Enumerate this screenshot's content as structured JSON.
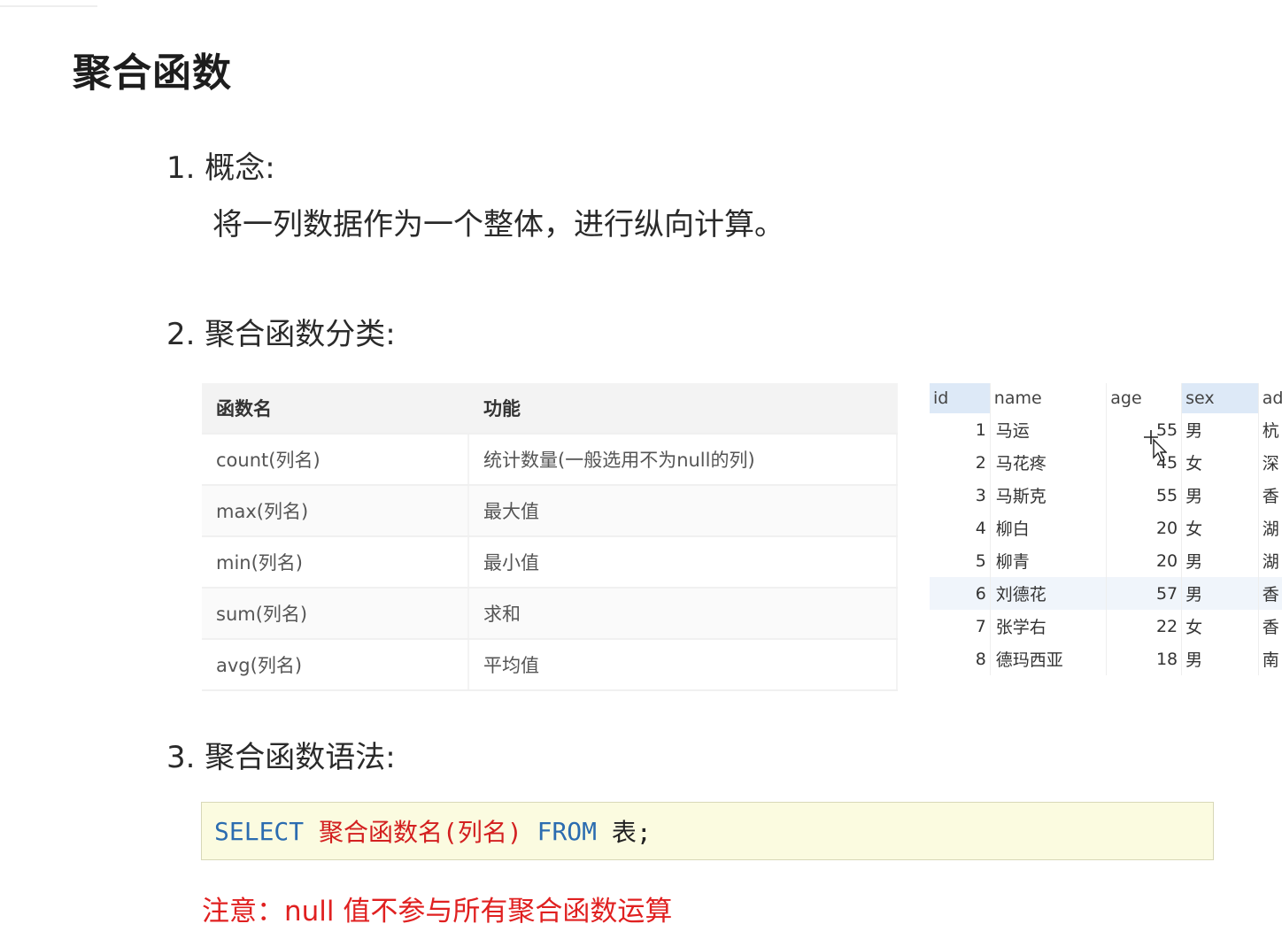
{
  "page_title": "聚合函数",
  "sections": {
    "concept_heading": "1. 概念:",
    "concept_body": "将一列数据作为一个整体，进行纵向计算。",
    "categories_heading": "2. 聚合函数分类:",
    "syntax_heading": "3. 聚合函数语法:"
  },
  "function_table": {
    "headers": [
      "函数名",
      "功能"
    ],
    "rows": [
      [
        "count(列名)",
        "统计数量(一般选用不为null的列)"
      ],
      [
        "max(列名)",
        "最大值"
      ],
      [
        "min(列名)",
        "最小值"
      ],
      [
        "sum(列名)",
        "求和"
      ],
      [
        "avg(列名)",
        "平均值"
      ]
    ]
  },
  "data_table": {
    "headers": [
      "id",
      "name",
      "age",
      "sex",
      "ad"
    ],
    "rows": [
      [
        "1",
        "马运",
        "55",
        "男",
        "杭"
      ],
      [
        "2",
        "马花疼",
        "45",
        "女",
        "深"
      ],
      [
        "3",
        "马斯克",
        "55",
        "男",
        "香"
      ],
      [
        "4",
        "柳白",
        "20",
        "女",
        "湖"
      ],
      [
        "5",
        "柳青",
        "20",
        "男",
        "湖"
      ],
      [
        "6",
        "刘德花",
        "57",
        "男",
        "香"
      ],
      [
        "7",
        "张学右",
        "22",
        "女",
        "香"
      ],
      [
        "8",
        "德玛西亚",
        "18",
        "男",
        "南"
      ]
    ]
  },
  "code": {
    "select_kw": "SELECT",
    "func_part": "聚合函数名(列名)",
    "from_kw": "FROM",
    "table_part": "表;"
  },
  "note": "注意：null 值不参与所有聚合函数运算",
  "colors": {
    "keyword": "#2b6cb0",
    "function_text": "#d32020",
    "note": "#e02020",
    "code_bg": "#fbfbe0"
  }
}
